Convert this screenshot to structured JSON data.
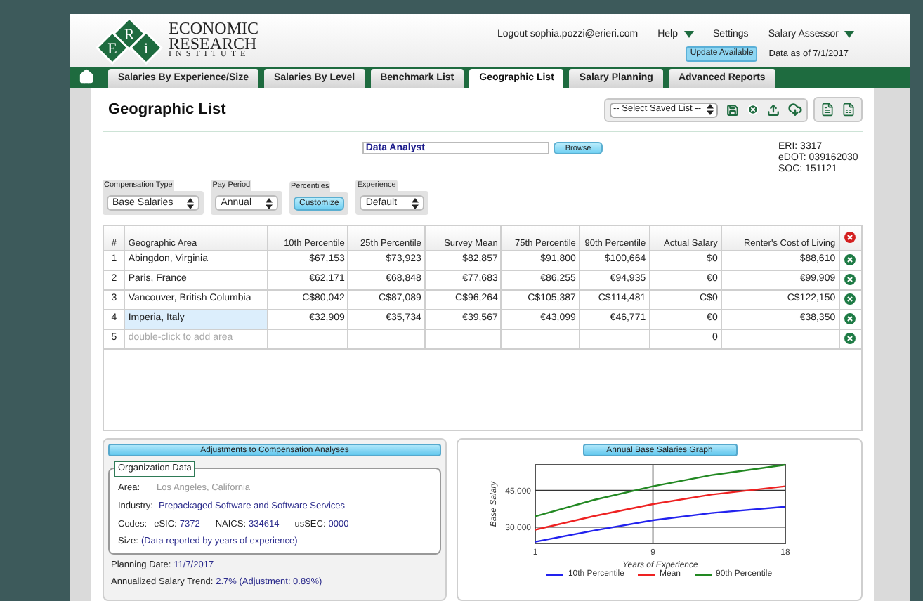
{
  "logo": {
    "letters": [
      "E",
      "R",
      "i"
    ],
    "lines": [
      "ECONOMIC",
      "RESEARCH",
      "INSTITUTE"
    ]
  },
  "header": {
    "account": "Logout sophia.pozzi@erieri.com",
    "menus": [
      {
        "label": "Help",
        "dropdown": true
      },
      {
        "label": "Settings",
        "dropdown": false
      },
      {
        "label": "Salary Assessor",
        "dropdown": true
      }
    ],
    "update_badge": "Update Available",
    "data_date": "Data as of 7/1/2017"
  },
  "tabs": [
    {
      "label": "Salaries By Experience/Size",
      "selected": false
    },
    {
      "label": "Salaries By Level",
      "selected": false
    },
    {
      "label": "Benchmark List",
      "selected": false
    },
    {
      "label": "Geographic List",
      "selected": true
    },
    {
      "label": "Salary Planning",
      "selected": false
    },
    {
      "label": "Advanced Reports",
      "selected": false
    }
  ],
  "page": {
    "title": "Geographic List",
    "saved_list": "-- Select Saved List --"
  },
  "job": {
    "value": "Data Analyst",
    "button": "Browse",
    "codes": [
      "ERI: 3317",
      "eDOT: 039162030",
      "SOC: 151121"
    ]
  },
  "filters": [
    {
      "label": "Compensation Type",
      "kind": "select",
      "value": "Base Salaries"
    },
    {
      "label": "Pay Period",
      "kind": "select",
      "value": "Annual"
    },
    {
      "label": "Percentiles",
      "kind": "button",
      "value": "Customize"
    },
    {
      "label": "Experience",
      "kind": "select",
      "value": "Default"
    }
  ],
  "table": {
    "columns": [
      "#",
      "Geographic Area",
      "10th Percentile",
      "25th Percentile",
      "Survey Mean",
      "75th Percentile",
      "90th Percentile",
      "Actual Salary",
      "Renter's Cost of Living"
    ],
    "rows": [
      {
        "kind": "area",
        "selected": false,
        "number": "1",
        "area": "Abingdon, Virginia",
        "values": [
          "$67,153",
          "$73,923",
          "$82,857",
          "$91,800",
          "$100,664",
          "$0",
          "$88,610"
        ]
      },
      {
        "kind": "area",
        "selected": false,
        "number": "2",
        "area": "Paris, France",
        "values": [
          "€62,171",
          "€68,848",
          "€77,683",
          "€86,255",
          "€94,935",
          "€0",
          "€99,909"
        ]
      },
      {
        "kind": "area",
        "selected": false,
        "number": "3",
        "area": "Vancouver, British Columbia",
        "values": [
          "C$80,042",
          "C$87,089",
          "C$96,264",
          "C$105,387",
          "C$114,481",
          "C$0",
          "C$122,150"
        ]
      },
      {
        "kind": "area",
        "selected": true,
        "number": "4",
        "area": "Imperia, Italy",
        "values": [
          "€32,909",
          "€35,734",
          "€39,567",
          "€43,099",
          "€46,771",
          "€0",
          "€38,350"
        ]
      },
      {
        "kind": "add",
        "selected": false,
        "number": "5",
        "placeholder": "double-click to add area",
        "actual_salary": "0"
      }
    ]
  },
  "adjustments": {
    "title": "Adjustments to Compensation Analyses",
    "org_title": "Organization Data",
    "fields": [
      {
        "label": "Area:",
        "value": "Los Angeles, California",
        "disabled": true
      },
      {
        "label": "Industry:",
        "value": "Prepackaged Software and Software Services",
        "disabled": false
      }
    ],
    "codes": {
      "label": "Codes:",
      "items": [
        {
          "label": "eSIC:",
          "value": "7372"
        },
        {
          "label": "NAICS:",
          "value": "334614"
        },
        {
          "label": "usSEC:",
          "value": "0000"
        }
      ]
    },
    "size": {
      "label": "Size:",
      "value": "(Data reported by years of experience)"
    },
    "planning": {
      "label": "Planning Date:",
      "value": "11/7/2017"
    },
    "trend": {
      "label": "Annualized Salary Trend:",
      "value": "2.7% (Adjustment: 0.89%)"
    }
  },
  "graph": {
    "title": "Annual Base Salaries Graph",
    "chart_data": {
      "type": "line",
      "xlabel": "Years of Experience",
      "ylabel": "Base Salary",
      "x": [
        1,
        5,
        9,
        13,
        18
      ],
      "series": [
        {
          "name": "10th Percentile",
          "color": "#2222ee",
          "values": [
            24000,
            28600,
            32800,
            35800,
            38300
          ]
        },
        {
          "name": "Mean",
          "color": "#ee2222",
          "values": [
            28900,
            34500,
            39400,
            43300,
            46700
          ]
        },
        {
          "name": "90th Percentile",
          "color": "#228822",
          "values": [
            34400,
            41100,
            46700,
            51300,
            55500
          ]
        }
      ],
      "grid": true,
      "legend": true,
      "xlim": [
        1,
        18
      ],
      "ylim": [
        23300,
        55500
      ],
      "xticks": [
        1,
        9,
        18
      ],
      "yticks": [
        {
          "value": 30000,
          "label": "30,000"
        },
        {
          "value": 45000,
          "label": "45,000"
        }
      ]
    }
  }
}
